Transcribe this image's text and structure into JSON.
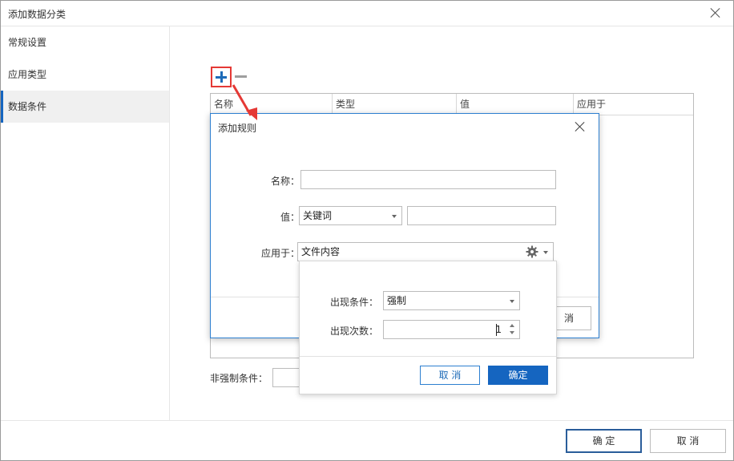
{
  "window": {
    "title": "添加数据分类"
  },
  "sidebar": {
    "items": [
      {
        "label": "常规设置"
      },
      {
        "label": "应用类型"
      },
      {
        "label": "数据条件"
      }
    ]
  },
  "rules_table": {
    "columns": [
      "名称",
      "类型",
      "值",
      "应用于"
    ]
  },
  "nonforce": {
    "label": "非强制条件：",
    "value": ""
  },
  "footer": {
    "ok_label": "确 定",
    "cancel_label": "取 消"
  },
  "rule_dialog": {
    "title": "添加规则",
    "name_label": "名称：",
    "name_value": "",
    "value_label": "值：",
    "value_type": "关键词",
    "value_text": "",
    "apply_label": "应用于：",
    "apply_value": "文件内容",
    "obscured_button_text": "消"
  },
  "apply_popup": {
    "condition_label": "出现条件：",
    "condition_value": "强制",
    "count_label": "出现次数：",
    "count_value": "1",
    "cancel_label": "取 消",
    "ok_label": "确定"
  },
  "colors": {
    "accent": "#1565c0",
    "highlight": "#e53935"
  }
}
